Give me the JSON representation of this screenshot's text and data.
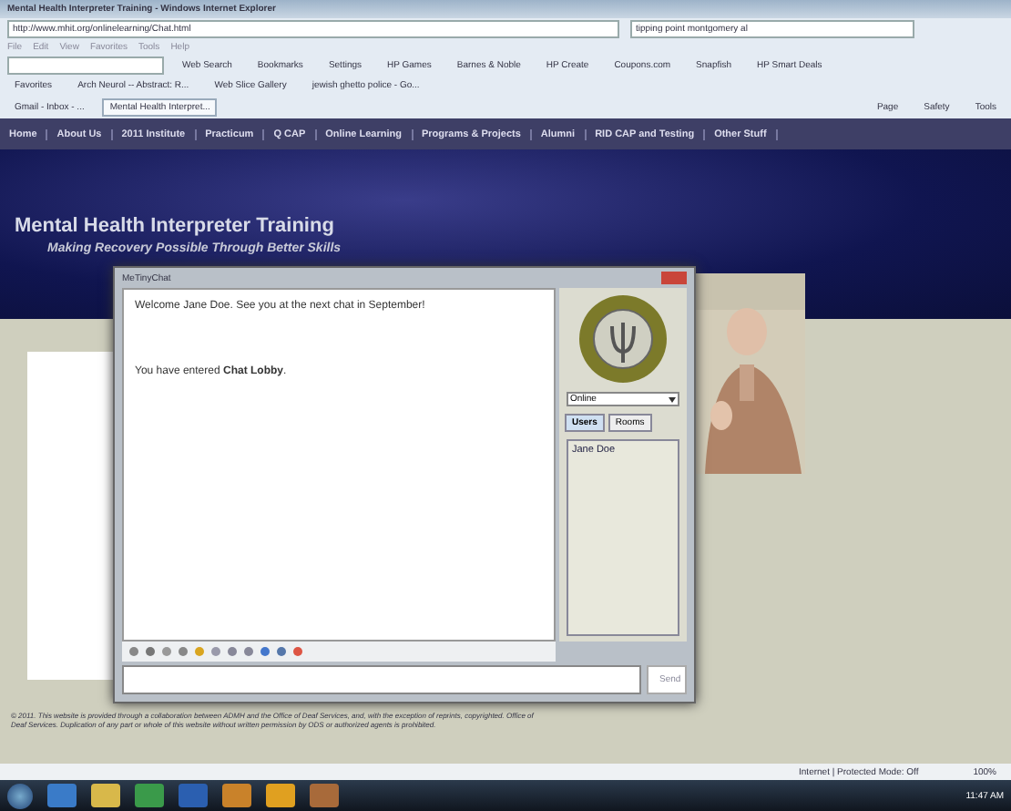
{
  "window": {
    "title": "Mental Health Interpreter Training - Windows Internet Explorer"
  },
  "address_bar": {
    "url": "http://www.mhit.org/onlinelearning/Chat.html",
    "search": "tipping point montgomery al"
  },
  "menu": [
    "File",
    "Edit",
    "View",
    "Favorites",
    "Tools",
    "Help"
  ],
  "toolbar": [
    "Web Search",
    "Bookmarks",
    "Settings",
    "HP Games",
    "Barnes & Noble",
    "HP Create",
    "Coupons.com",
    "Snapfish",
    "HP Smart Deals"
  ],
  "favorites": [
    "Favorites",
    "Arch Neurol -- Abstract: R...",
    "Web Slice Gallery",
    "jewish ghetto police - Go..."
  ],
  "browser_tabs": [
    {
      "label": "Gmail - Inbox - ...",
      "selected": false
    },
    {
      "label": "Mental Health Interpret...",
      "selected": true
    }
  ],
  "command_bar": [
    "Page",
    "Safety",
    "Tools"
  ],
  "site_nav": [
    "Home",
    "About Us",
    "2011 Institute",
    "Practicum",
    "Q CAP",
    "Online Learning",
    "Programs & Projects",
    "Alumni",
    "RID CAP and Testing",
    "Other Stuff"
  ],
  "site": {
    "title": "Mental Health Interpreter Training",
    "tagline": "Making Recovery Possible Through Better Skills"
  },
  "chat": {
    "title": "MeTinyChat",
    "messages": [
      "Welcome Jane Doe. See you at the next chat in September!",
      "You have entered **Chat Lobby**."
    ],
    "status": "Online",
    "tabs": [
      {
        "label": "Users",
        "selected": true
      },
      {
        "label": "Rooms",
        "selected": false
      }
    ],
    "users": [
      "Jane Doe"
    ],
    "send": "Send"
  },
  "footer": "© 2011. This website is provided through a collaboration between ADMH and the Office of Deaf Services, and, with the exception of reprints, copyrighted. Office of Deaf Services. Duplication of any part or whole of this website without written permission by ODS or authorized agents is prohibited.",
  "status_bar": {
    "zone": "Internet | Protected Mode: Off",
    "zoom": "100%"
  },
  "taskbar": {
    "time": "11:47 AM"
  }
}
